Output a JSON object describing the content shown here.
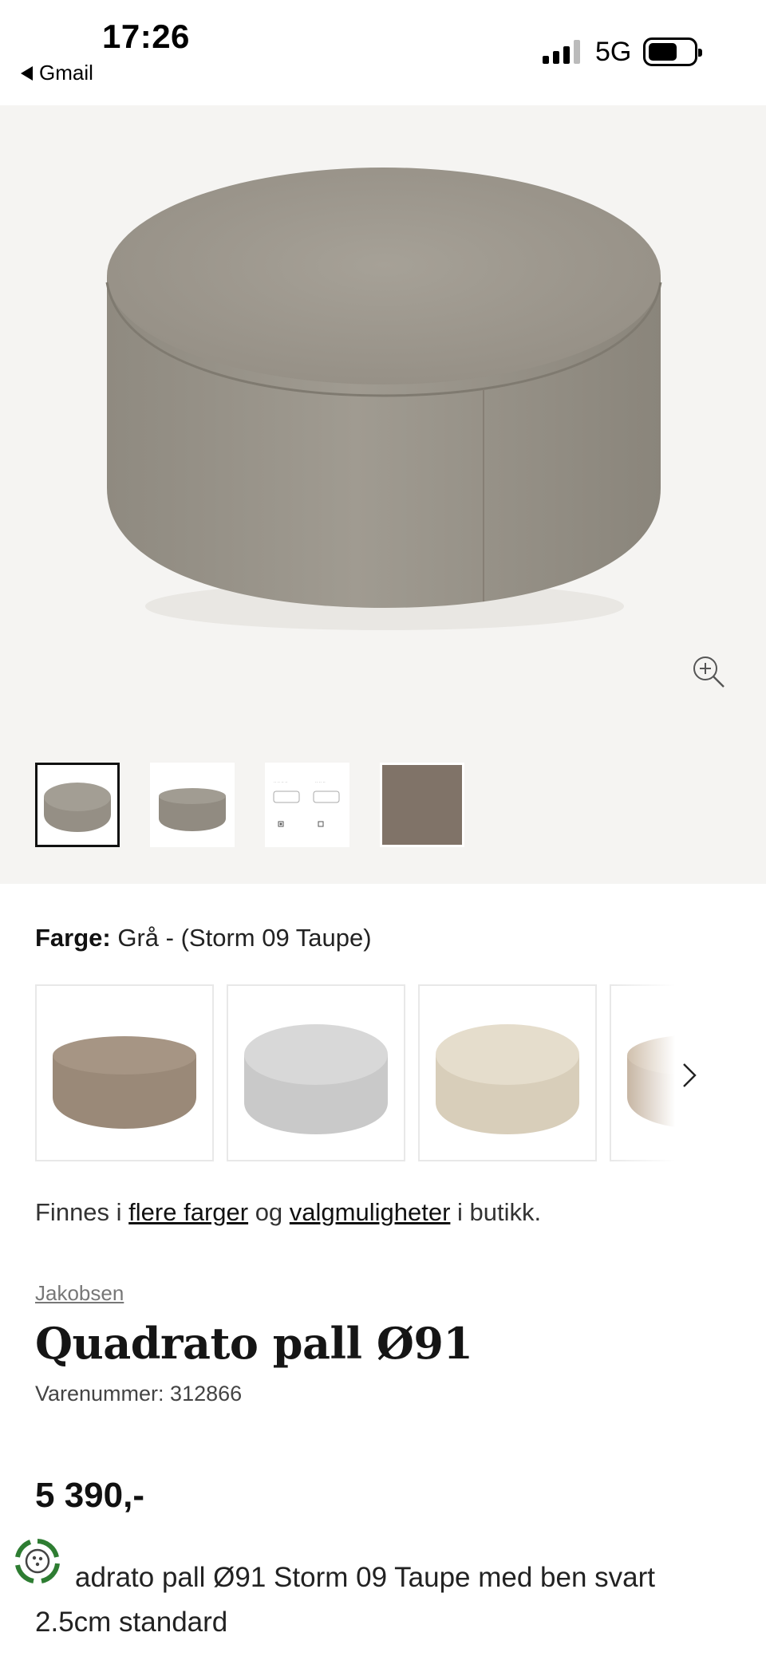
{
  "status_bar": {
    "time": "17:26",
    "back_app": "Gmail",
    "network": "5G"
  },
  "gallery": {
    "thumbnails": [
      "ottoman-top",
      "ottoman-side",
      "leg-options",
      "fabric-swatch"
    ],
    "active_index": 0
  },
  "product": {
    "color_label": "Farge:",
    "color_value": "Grå - (Storm 09 Taupe)",
    "availability": {
      "prefix": "Finnes i ",
      "link1": "flere farger",
      "middle": " og ",
      "link2": "valgmuligheter",
      "suffix": " i butikk."
    },
    "brand": "Jakobsen",
    "title": "Quadrato pall Ø91",
    "sku": "Varenummer: 312866",
    "price": "5 390,-",
    "description_line1": "adrato pall Ø91 Storm 09 Taupe med ben svart",
    "description_line2": "2.5cm standard"
  },
  "swatches": [
    {
      "name": "Taupe brown",
      "color": "#a08f7e"
    },
    {
      "name": "Light grey",
      "color": "#cfcfcf"
    },
    {
      "name": "Beige",
      "color": "#ddd3c0"
    },
    {
      "name": "Tan",
      "color": "#b9a289"
    }
  ],
  "colors": {
    "gallery_bg": "#f5f4f2",
    "ottoman_main": "#9b968c",
    "text_dark": "#111111"
  }
}
